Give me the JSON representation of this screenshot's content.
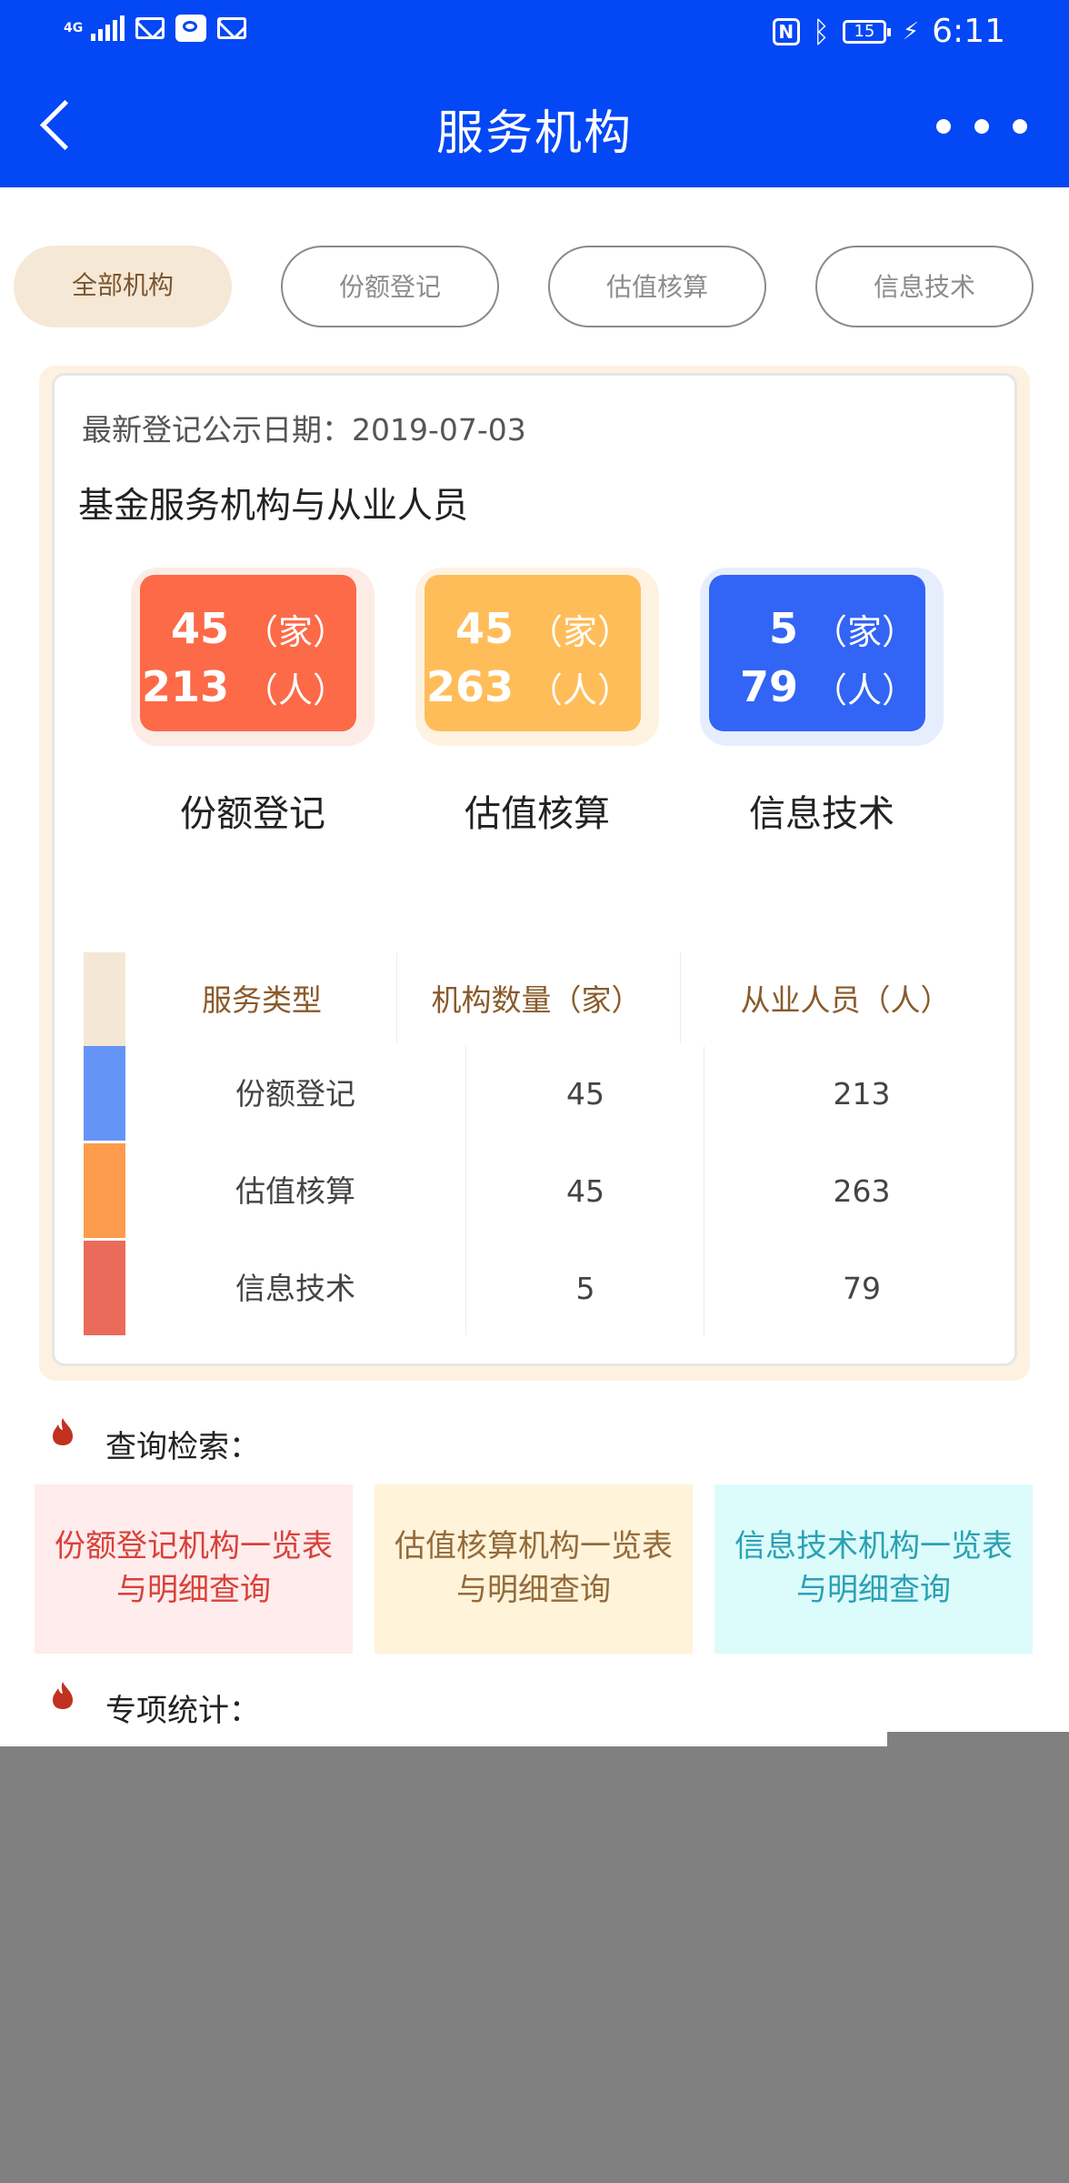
{
  "status_bar": {
    "network": "4G",
    "battery": "15",
    "time": "6:11",
    "icons": [
      "signal-icon",
      "mail-icon",
      "chat-icon",
      "mail-icon",
      "nfc-icon",
      "bluetooth-icon",
      "battery-icon",
      "charging-icon"
    ]
  },
  "header": {
    "title": "服务机构",
    "back_icon": "chevron-left-icon",
    "more_icon": "more-horizontal-icon"
  },
  "tabs": [
    {
      "label": "全部机构",
      "active": true
    },
    {
      "label": "份额登记",
      "active": false
    },
    {
      "label": "估值核算",
      "active": false
    },
    {
      "label": "信息技术",
      "active": false
    }
  ],
  "summary": {
    "publish_date": "最新登记公示日期：2019-07-03",
    "subtitle": "基金服务机构与从业人员",
    "cards": [
      {
        "label": "份额登记",
        "institutions": "45",
        "institution_unit": "（家）",
        "staff": "213",
        "staff_unit": "（人）",
        "color": "#fc6a48"
      },
      {
        "label": "估值核算",
        "institutions": "45",
        "institution_unit": "（家）",
        "staff": "263",
        "staff_unit": "（人）",
        "color": "#ffbd5a"
      },
      {
        "label": "信息技术",
        "institutions": "5",
        "institution_unit": "（家）",
        "staff": "79",
        "staff_unit": "（人）",
        "color": "#3264f5"
      }
    ]
  },
  "table": {
    "headers": [
      "服务类型",
      "机构数量（家）",
      "从业人员（人）"
    ],
    "rows": [
      {
        "type": "份额登记",
        "institutions": "45",
        "staff": "213",
        "color": "#6495f6"
      },
      {
        "type": "估值核算",
        "institutions": "45",
        "staff": "263",
        "color": "#fe9c4e"
      },
      {
        "type": "信息技术",
        "institutions": "5",
        "staff": "79",
        "color": "#eb6b5a"
      }
    ],
    "header_color": "#f5e7d5"
  },
  "query": {
    "title": "查询检索：",
    "buttons": [
      {
        "line1": "份额登记机构一览表",
        "line2": "与明细查询",
        "bg": "#ffecec",
        "fg": "#d8423a"
      },
      {
        "line1": "估值核算机构一览表",
        "line2": "与明细查询",
        "bg": "#fff3d9",
        "fg": "#946b3b"
      },
      {
        "line1": "信息技术机构一览表",
        "line2": "与明细查询",
        "bg": "#dcfbfb",
        "fg": "#2aa1b5"
      }
    ]
  },
  "stats_section": {
    "title": "专项统计："
  }
}
